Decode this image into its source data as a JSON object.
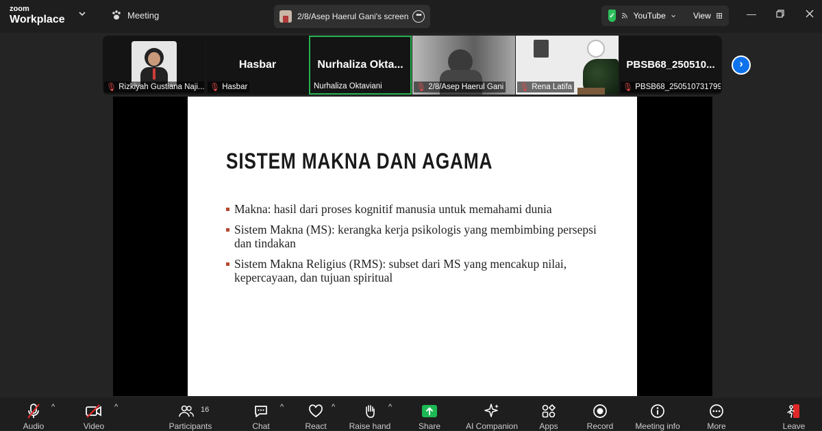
{
  "app": {
    "brand_top": "zoom",
    "brand_bottom": "Workplace"
  },
  "topbar": {
    "meeting_label": "Meeting",
    "share_label": "2/8/Asep Haerul Gani's screen",
    "youtube_label": "YouTube",
    "view_label": "View"
  },
  "participants": [
    {
      "caption": "Rizkiyah Gustiana Naji...",
      "big": "",
      "muted": true
    },
    {
      "caption": "Hasbar",
      "big": "Hasbar",
      "muted": true
    },
    {
      "caption": "Nurhaliza Oktaviani",
      "big": "Nurhaliza  Okta...",
      "muted": false,
      "active": true
    },
    {
      "caption": "2/8/Asep Haerul Gani",
      "big": "",
      "muted": true
    },
    {
      "caption": "Rena Latifa",
      "big": "",
      "muted": true
    },
    {
      "caption": "PBSB68_250510731799...",
      "big": "PBSB68_250510...",
      "muted": true
    }
  ],
  "slide": {
    "title": "SISTEM MAKNA DAN AGAMA",
    "bullets": [
      "Makna: hasil dari proses kognitif manusia untuk memahami dunia",
      "Sistem Makna (MS): kerangka kerja psikologis yang membimbing persepsi dan tindakan",
      "Sistem Makna Religius (RMS): subset dari MS yang mencakup nilai, kepercayaan, dan tujuan spiritual"
    ]
  },
  "toolbar": {
    "audio": "Audio",
    "video": "Video",
    "participants": "Participants",
    "participants_count": "16",
    "chat": "Chat",
    "react": "React",
    "raise_hand": "Raise hand",
    "share": "Share",
    "ai_companion": "AI Companion",
    "apps": "Apps",
    "record": "Record",
    "meeting_info": "Meeting info",
    "more": "More",
    "leave": "Leave"
  },
  "colors": {
    "accent_green": "#27b350",
    "share_green": "#1db954",
    "leave_red": "#e02828",
    "bullet": "#b5482f"
  }
}
